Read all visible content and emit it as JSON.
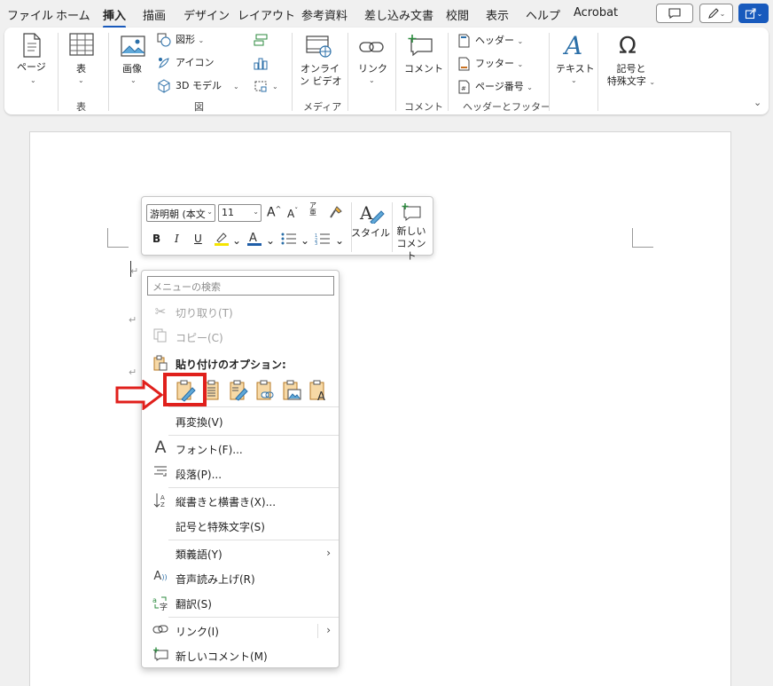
{
  "menubar": {
    "tabs": [
      "ファイル",
      "ホーム",
      "挿入",
      "描画",
      "デザイン",
      "レイアウト",
      "参考資料",
      "差し込み文書",
      "校閲",
      "表示",
      "ヘルプ",
      "Acrobat"
    ],
    "active_tab": "挿入"
  },
  "ribbon": {
    "page": {
      "label": "ページ"
    },
    "table": {
      "label": "表",
      "group": "表"
    },
    "illustrations": {
      "image": "画像",
      "shapes": "図形",
      "icons": "アイコン",
      "model3d": "3D モデル",
      "group": "図"
    },
    "media": {
      "online_video_line1": "オンライ",
      "online_video_line2": "ン ビデオ",
      "group": "メディア"
    },
    "links": {
      "link": "リンク"
    },
    "comments": {
      "comment": "コメント",
      "group": "コメント"
    },
    "header_footer": {
      "header": "ヘッダー",
      "footer": "フッター",
      "page_number": "ページ番号",
      "group": "ヘッダーとフッター"
    },
    "text": {
      "text": "テキスト"
    },
    "symbols": {
      "line1": "記号と",
      "line2": "特殊文字"
    }
  },
  "mini_toolbar": {
    "font": "游明朝 (本文",
    "size": "11",
    "style": "スタイル",
    "new_comment_line1": "新しい",
    "new_comment_line2": "コメント"
  },
  "context_menu": {
    "search_placeholder": "メニューの検索",
    "items": {
      "cut": "切り取り(T)",
      "copy": "コピー(C)",
      "paste_options": "貼り付けのオプション:",
      "reconvert": "再変換(V)",
      "font": "フォント(F)...",
      "paragraph": "段落(P)...",
      "text_direction": "縦書きと横書き(X)...",
      "symbols": "記号と特殊文字(S)",
      "synonyms": "類義語(Y)",
      "read_aloud": "音声読み上げ(R)",
      "translate": "翻訳(S)",
      "link": "リンク(I)",
      "new_comment": "新しいコメント(M)"
    }
  },
  "colors": {
    "accent": "#185abd",
    "highlight_box": "#e0201c",
    "highlight_yellow": "#f5e400",
    "font_color_blue": "#1f5ea8"
  }
}
